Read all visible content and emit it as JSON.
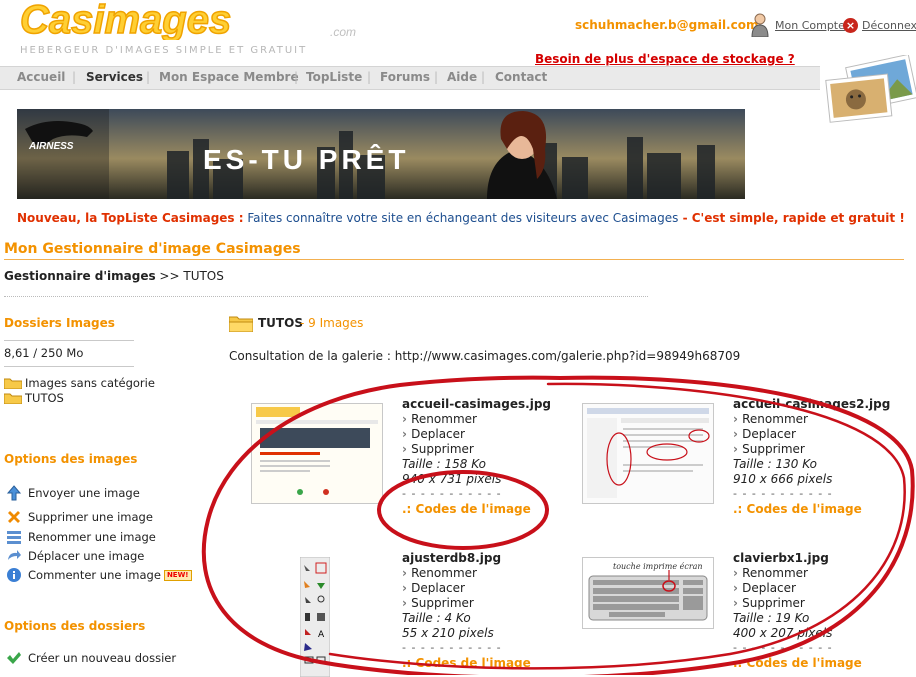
{
  "header": {
    "logo_text": "Casimages",
    "logo_suffix": ".com",
    "tagline": "HEBERGEUR D'IMAGES SIMPLE ET GRATUIT",
    "user_email": "schuhmacher.b@gmail.com",
    "account_label": "Mon Compte",
    "logout_label": "Déconnexio",
    "storage_link": "Besoin de plus d'espace de stockage ?"
  },
  "nav": {
    "items": [
      "Accueil",
      "Services",
      "Mon Espace Membre",
      "TopListe",
      "Forums",
      "Aide",
      "Contact"
    ],
    "active": "Services"
  },
  "banner": {
    "brand": "AIRNESS",
    "slogan": "ES-TU PRÊT"
  },
  "news": {
    "part1": "Nouveau, la TopListe Casimages :",
    "part2": " Faites connaître votre site en échangeant des visiteurs avec Casimages",
    "part3": " - C'est simple, rapide et gratuit !"
  },
  "page": {
    "title": "Mon Gestionnaire d'image Casimages",
    "breadcrumb_root": "Gestionnaire d'images",
    "breadcrumb_sep": " >> ",
    "breadcrumb_current": "TUTOS"
  },
  "sidebar": {
    "folders_title": "Dossiers Images",
    "storage_usage": "8,61 / 250 Mo",
    "folders": [
      "Images sans catégorie",
      "TUTOS"
    ],
    "image_options_title": "Options des images",
    "image_options": [
      {
        "label": "Envoyer une image",
        "icon": "upload-icon"
      },
      {
        "label": "Supprimer une image",
        "icon": "delete-icon"
      },
      {
        "label": "Renommer une image",
        "icon": "rename-icon"
      },
      {
        "label": "Déplacer une image",
        "icon": "move-icon"
      },
      {
        "label": "Commenter une image",
        "icon": "comment-icon",
        "badge": "NEW!"
      }
    ],
    "folder_options_title": "Options des dossiers",
    "folder_options": [
      {
        "label": "Créer un nouveau dossier",
        "icon": "check-icon"
      }
    ]
  },
  "gallery": {
    "folder_name": "TUTOS",
    "count": " - 9 Images",
    "consult_label": "Consultation de la galerie :",
    "consult_url": "http://www.casimages.com/galerie.php?id=98949h68709",
    "actions": [
      "Renommer",
      "Deplacer",
      "Supprimer"
    ],
    "codes_label": ".: Codes de l'image",
    "dashes": "- - - - - - - - - - -",
    "images": [
      {
        "filename": "accueil-casimages.jpg",
        "size": "Taille : 158 Ko",
        "dims": "940 x 731 pixels"
      },
      {
        "filename": "accueil-casimages2.jpg",
        "size": "Taille : 130 Ko",
        "dims": "910 x 666 pixels"
      },
      {
        "filename": "ajusterdb8.jpg",
        "size": "Taille : 4 Ko",
        "dims": "55 x 210 pixels"
      },
      {
        "filename": "clavierbx1.jpg",
        "size": "Taille : 19 Ko",
        "dims": "400 x 207 pixels"
      }
    ],
    "keyboard_caption": "touche imprime écran"
  },
  "colors": {
    "accent": "#f39200",
    "news_red": "#e03000",
    "news_blue": "#1d4e8f",
    "annotation_red": "#c8101a"
  }
}
